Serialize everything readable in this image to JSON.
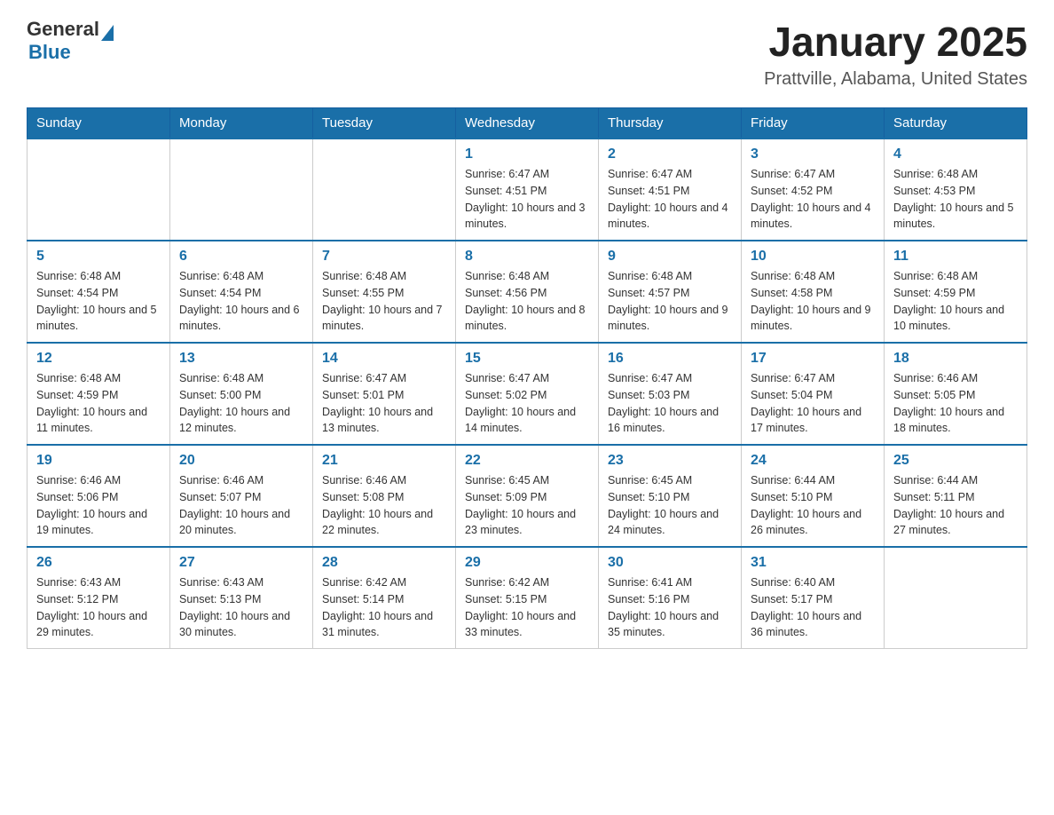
{
  "header": {
    "logo": {
      "general": "General",
      "blue": "Blue"
    },
    "title": "January 2025",
    "subtitle": "Prattville, Alabama, United States"
  },
  "days_of_week": [
    "Sunday",
    "Monday",
    "Tuesday",
    "Wednesday",
    "Thursday",
    "Friday",
    "Saturday"
  ],
  "weeks": [
    [
      {
        "day": "",
        "info": ""
      },
      {
        "day": "",
        "info": ""
      },
      {
        "day": "",
        "info": ""
      },
      {
        "day": "1",
        "info": "Sunrise: 6:47 AM\nSunset: 4:51 PM\nDaylight: 10 hours and 3 minutes."
      },
      {
        "day": "2",
        "info": "Sunrise: 6:47 AM\nSunset: 4:51 PM\nDaylight: 10 hours and 4 minutes."
      },
      {
        "day": "3",
        "info": "Sunrise: 6:47 AM\nSunset: 4:52 PM\nDaylight: 10 hours and 4 minutes."
      },
      {
        "day": "4",
        "info": "Sunrise: 6:48 AM\nSunset: 4:53 PM\nDaylight: 10 hours and 5 minutes."
      }
    ],
    [
      {
        "day": "5",
        "info": "Sunrise: 6:48 AM\nSunset: 4:54 PM\nDaylight: 10 hours and 5 minutes."
      },
      {
        "day": "6",
        "info": "Sunrise: 6:48 AM\nSunset: 4:54 PM\nDaylight: 10 hours and 6 minutes."
      },
      {
        "day": "7",
        "info": "Sunrise: 6:48 AM\nSunset: 4:55 PM\nDaylight: 10 hours and 7 minutes."
      },
      {
        "day": "8",
        "info": "Sunrise: 6:48 AM\nSunset: 4:56 PM\nDaylight: 10 hours and 8 minutes."
      },
      {
        "day": "9",
        "info": "Sunrise: 6:48 AM\nSunset: 4:57 PM\nDaylight: 10 hours and 9 minutes."
      },
      {
        "day": "10",
        "info": "Sunrise: 6:48 AM\nSunset: 4:58 PM\nDaylight: 10 hours and 9 minutes."
      },
      {
        "day": "11",
        "info": "Sunrise: 6:48 AM\nSunset: 4:59 PM\nDaylight: 10 hours and 10 minutes."
      }
    ],
    [
      {
        "day": "12",
        "info": "Sunrise: 6:48 AM\nSunset: 4:59 PM\nDaylight: 10 hours and 11 minutes."
      },
      {
        "day": "13",
        "info": "Sunrise: 6:48 AM\nSunset: 5:00 PM\nDaylight: 10 hours and 12 minutes."
      },
      {
        "day": "14",
        "info": "Sunrise: 6:47 AM\nSunset: 5:01 PM\nDaylight: 10 hours and 13 minutes."
      },
      {
        "day": "15",
        "info": "Sunrise: 6:47 AM\nSunset: 5:02 PM\nDaylight: 10 hours and 14 minutes."
      },
      {
        "day": "16",
        "info": "Sunrise: 6:47 AM\nSunset: 5:03 PM\nDaylight: 10 hours and 16 minutes."
      },
      {
        "day": "17",
        "info": "Sunrise: 6:47 AM\nSunset: 5:04 PM\nDaylight: 10 hours and 17 minutes."
      },
      {
        "day": "18",
        "info": "Sunrise: 6:46 AM\nSunset: 5:05 PM\nDaylight: 10 hours and 18 minutes."
      }
    ],
    [
      {
        "day": "19",
        "info": "Sunrise: 6:46 AM\nSunset: 5:06 PM\nDaylight: 10 hours and 19 minutes."
      },
      {
        "day": "20",
        "info": "Sunrise: 6:46 AM\nSunset: 5:07 PM\nDaylight: 10 hours and 20 minutes."
      },
      {
        "day": "21",
        "info": "Sunrise: 6:46 AM\nSunset: 5:08 PM\nDaylight: 10 hours and 22 minutes."
      },
      {
        "day": "22",
        "info": "Sunrise: 6:45 AM\nSunset: 5:09 PM\nDaylight: 10 hours and 23 minutes."
      },
      {
        "day": "23",
        "info": "Sunrise: 6:45 AM\nSunset: 5:10 PM\nDaylight: 10 hours and 24 minutes."
      },
      {
        "day": "24",
        "info": "Sunrise: 6:44 AM\nSunset: 5:10 PM\nDaylight: 10 hours and 26 minutes."
      },
      {
        "day": "25",
        "info": "Sunrise: 6:44 AM\nSunset: 5:11 PM\nDaylight: 10 hours and 27 minutes."
      }
    ],
    [
      {
        "day": "26",
        "info": "Sunrise: 6:43 AM\nSunset: 5:12 PM\nDaylight: 10 hours and 29 minutes."
      },
      {
        "day": "27",
        "info": "Sunrise: 6:43 AM\nSunset: 5:13 PM\nDaylight: 10 hours and 30 minutes."
      },
      {
        "day": "28",
        "info": "Sunrise: 6:42 AM\nSunset: 5:14 PM\nDaylight: 10 hours and 31 minutes."
      },
      {
        "day": "29",
        "info": "Sunrise: 6:42 AM\nSunset: 5:15 PM\nDaylight: 10 hours and 33 minutes."
      },
      {
        "day": "30",
        "info": "Sunrise: 6:41 AM\nSunset: 5:16 PM\nDaylight: 10 hours and 35 minutes."
      },
      {
        "day": "31",
        "info": "Sunrise: 6:40 AM\nSunset: 5:17 PM\nDaylight: 10 hours and 36 minutes."
      },
      {
        "day": "",
        "info": ""
      }
    ]
  ]
}
